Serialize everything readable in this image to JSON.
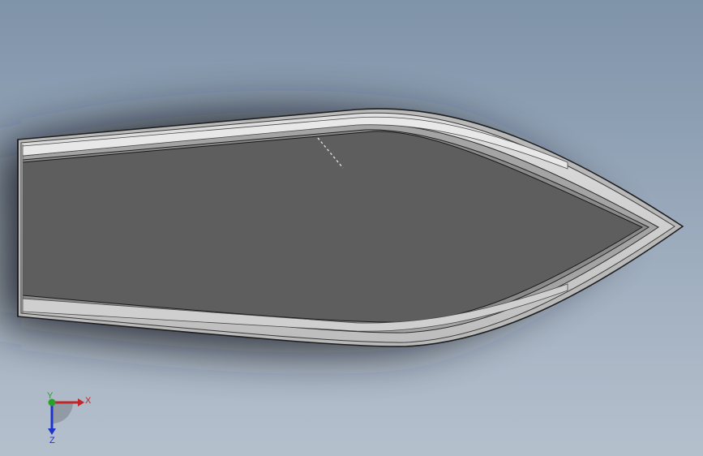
{
  "viewport": {
    "background_top": "#7f93a9",
    "background_bottom": "#b5c0cd"
  },
  "model": {
    "part": "boat-hull",
    "view": "top",
    "deck_color": "#5e5e5e",
    "rim_light_color": "#d2d2d2",
    "rim_mid_color": "#a9a9a9",
    "edge_color": "#2a2a2a"
  },
  "triad": {
    "x_label": "X",
    "y_label": "Y",
    "z_label": "Z",
    "x_color": "#c0262a",
    "y_color": "#2aa12a",
    "z_color": "#1f33c8"
  }
}
